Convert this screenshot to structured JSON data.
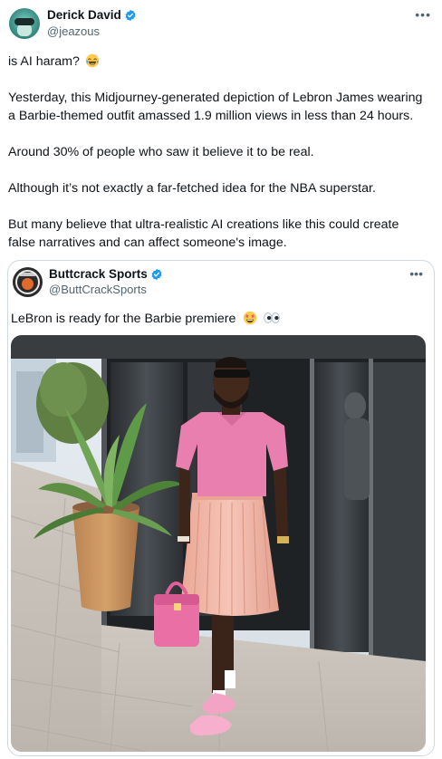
{
  "author": {
    "name": "Derick David",
    "handle": "@jeazous",
    "verified": true,
    "more_icon": "more-horizontal-icon"
  },
  "tweet": {
    "paragraphs": [
      "is AI haram?",
      "Yesterday, this Midjourney-generated depiction of Lebron James wearing",
      "a Barbie-themed outfit amassed 1.9 million views in less than 24 hours.",
      "Around 30% of people who saw it believe it to be real.",
      "Although it’s not exactly a far-fetched idea for the NBA superstar.",
      "But many believe that ultra-realistic AI creations like this could create",
      "false narratives and can affect someone's image."
    ],
    "emoji_first": "face-with-tears-of-joy"
  },
  "quoted": {
    "name": "Buttcrack Sports",
    "handle": "@ButtCrackSports",
    "verified": true,
    "text": "LeBron is ready for the Barbie premiere",
    "emojis": [
      "star-struck-face",
      "eyes"
    ]
  },
  "colors": {
    "verified_blue": "#1d9bf0",
    "text_primary": "#0f1419",
    "text_secondary": "#536471",
    "border": "#cfd9de",
    "pink_shirt": "#e87fae",
    "skirt": "#f1b9ab"
  }
}
